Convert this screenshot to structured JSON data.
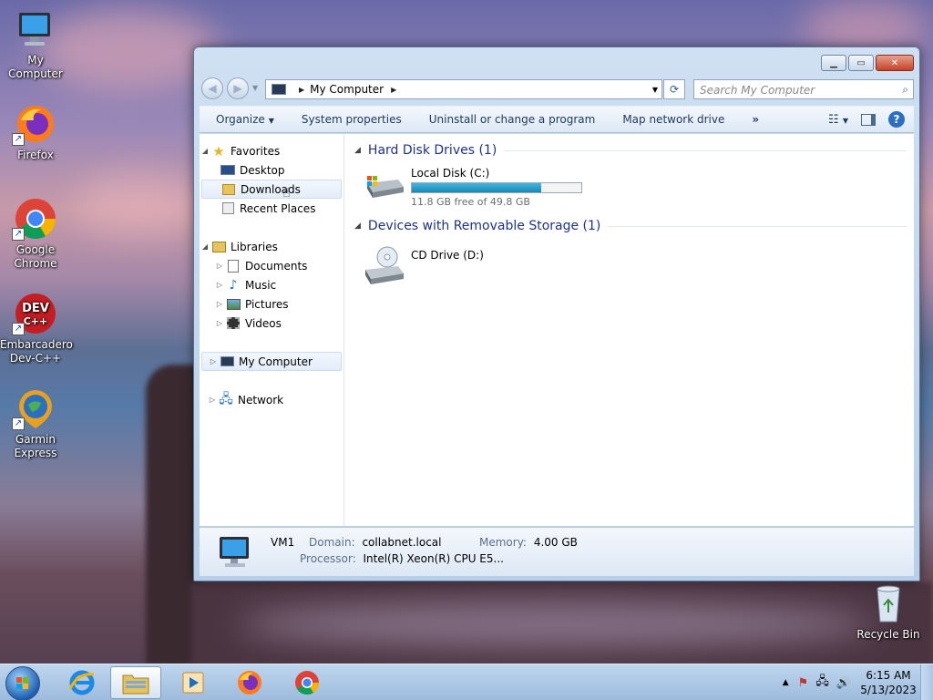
{
  "desktop": {
    "icons": [
      {
        "label": "My Computer"
      },
      {
        "label": "Firefox"
      },
      {
        "label": "Google Chrome"
      },
      {
        "label": "Embarcadero Dev-C++"
      },
      {
        "label": "Garmin Express"
      },
      {
        "label": "Recycle Bin"
      }
    ]
  },
  "window": {
    "address": {
      "crumb": "My Computer"
    },
    "search": {
      "placeholder": "Search My Computer"
    },
    "toolbar": {
      "organize": "Organize",
      "system_properties": "System properties",
      "uninstall": "Uninstall or change a program",
      "map_drive": "Map network drive",
      "more": "»"
    },
    "nav": {
      "favorites": "Favorites",
      "desktop": "Desktop",
      "downloads": "Downloads",
      "recent": "Recent Places",
      "libraries": "Libraries",
      "documents": "Documents",
      "music": "Music",
      "pictures": "Pictures",
      "videos": "Videos",
      "my_computer": "My Computer",
      "network": "Network"
    },
    "groups": {
      "hdd": "Hard Disk Drives (1)",
      "removable": "Devices with Removable Storage (1)"
    },
    "drives": {
      "c_name": "Local Disk (C:)",
      "c_free": "11.8 GB free of 49.8 GB",
      "c_used_fraction": 0.763,
      "d_name": "CD Drive (D:)"
    },
    "details": {
      "name": "VM1",
      "domain_label": "Domain:",
      "domain": "collabnet.local",
      "memory_label": "Memory:",
      "memory": "4.00 GB",
      "processor_label": "Processor:",
      "processor": "Intel(R) Xeon(R) CPU E5..."
    }
  },
  "taskbar": {
    "time": "6:15 AM",
    "date": "5/13/2023"
  }
}
